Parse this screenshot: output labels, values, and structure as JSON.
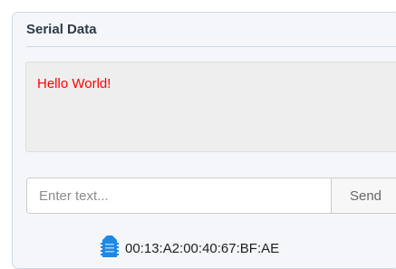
{
  "panel": {
    "title": "Serial Data",
    "output_lines": [
      "Hello World!"
    ],
    "output_color": "#ff0000"
  },
  "input": {
    "placeholder": "Enter text...",
    "value": ""
  },
  "send_button": {
    "label": "Send"
  },
  "device": {
    "icon": "xbee-module-icon",
    "icon_color": "#1e88e5",
    "address": "00:13:A2:00:40:67:BF:AE"
  }
}
